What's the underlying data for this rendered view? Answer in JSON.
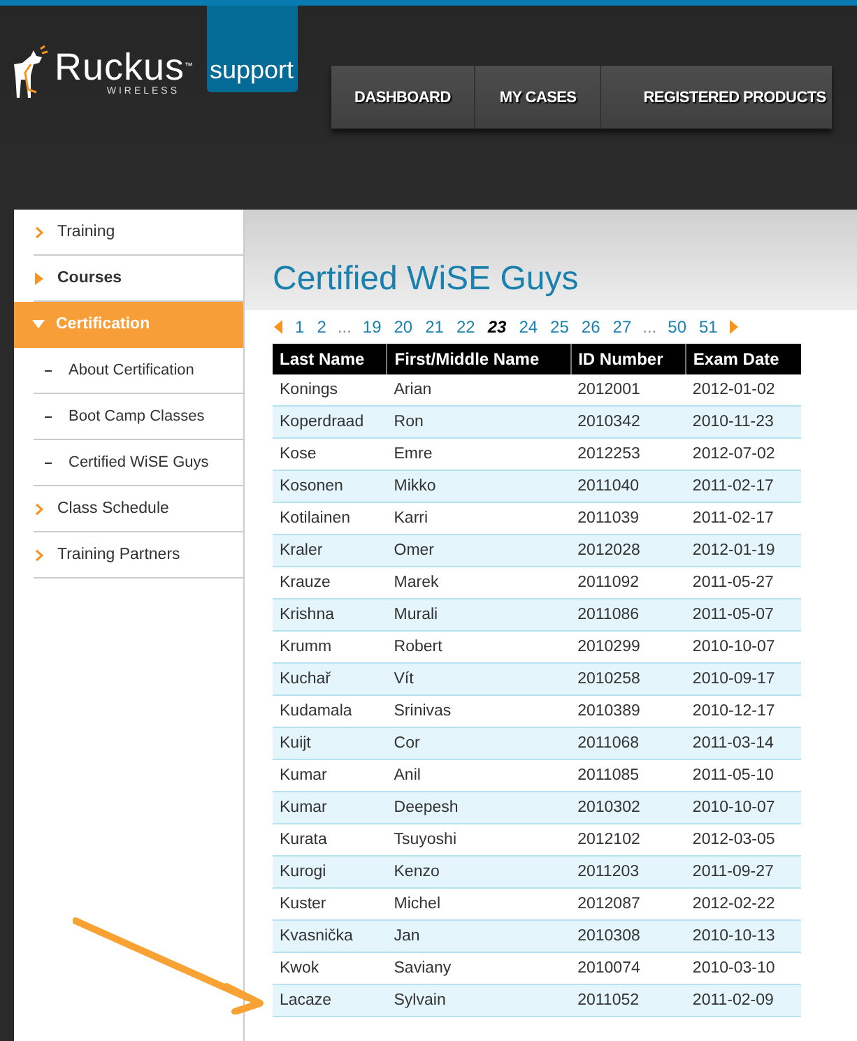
{
  "header": {
    "logo_text": "Ruckus",
    "logo_subtext": "WIRELESS",
    "logo_tm": "™",
    "support_tab": "support",
    "nav": [
      {
        "label": "DASHBOARD"
      },
      {
        "label": "MY CASES"
      },
      {
        "label": "REGISTERED PRODUCTS"
      }
    ]
  },
  "sidebar": {
    "items": [
      {
        "label": "Training",
        "kind": "link",
        "selected": false
      },
      {
        "label": "Courses",
        "kind": "bold",
        "selected": false
      },
      {
        "label": "Certification",
        "kind": "parent",
        "selected": true,
        "expanded": true
      },
      {
        "label": "About Certification",
        "kind": "sub",
        "selected": false
      },
      {
        "label": "Boot Camp Classes",
        "kind": "sub",
        "selected": false
      },
      {
        "label": "Certified WiSE Guys",
        "kind": "sub",
        "selected": false
      },
      {
        "label": "Class Schedule",
        "kind": "link",
        "selected": false
      },
      {
        "label": "Training Partners",
        "kind": "link",
        "selected": false
      }
    ]
  },
  "page_title": "Certified WiSE Guys",
  "pagination": [
    {
      "label": "1",
      "kind": "page",
      "selected": false
    },
    {
      "label": "2",
      "kind": "page",
      "selected": false
    },
    {
      "label": "...",
      "kind": "ellipsis"
    },
    {
      "label": "19",
      "kind": "page",
      "selected": false
    },
    {
      "label": "20",
      "kind": "page",
      "selected": false
    },
    {
      "label": "21",
      "kind": "page",
      "selected": false
    },
    {
      "label": "22",
      "kind": "page",
      "selected": false
    },
    {
      "label": "23",
      "kind": "page",
      "selected": true
    },
    {
      "label": "24",
      "kind": "page",
      "selected": false
    },
    {
      "label": "25",
      "kind": "page",
      "selected": false
    },
    {
      "label": "26",
      "kind": "page",
      "selected": false
    },
    {
      "label": "27",
      "kind": "page",
      "selected": false
    },
    {
      "label": "...",
      "kind": "ellipsis"
    },
    {
      "label": "50",
      "kind": "page",
      "selected": false
    },
    {
      "label": "51",
      "kind": "page",
      "selected": false
    }
  ],
  "table": {
    "columns": [
      "Last Name",
      "First/Middle Name",
      "ID Number",
      "Exam Date"
    ],
    "rows": [
      [
        "Konings",
        "Arian",
        "2012001",
        "2012-01-02"
      ],
      [
        "Koperdraad",
        "Ron",
        "2010342",
        "2010-11-23"
      ],
      [
        "Kose",
        "Emre",
        "2012253",
        "2012-07-02"
      ],
      [
        "Kosonen",
        "Mikko",
        "2011040",
        "2011-02-17"
      ],
      [
        "Kotilainen",
        "Karri",
        "2011039",
        "2011-02-17"
      ],
      [
        "Kraler",
        "Omer",
        "2012028",
        "2012-01-19"
      ],
      [
        "Krauze",
        "Marek",
        "2011092",
        "2011-05-27"
      ],
      [
        "Krishna",
        "Murali",
        "2011086",
        "2011-05-07"
      ],
      [
        "Krumm",
        "Robert",
        "2010299",
        "2010-10-07"
      ],
      [
        "Kuchař",
        "Vít",
        "2010258",
        "2010-09-17"
      ],
      [
        "Kudamala",
        "Srinivas",
        "2010389",
        "2010-12-17"
      ],
      [
        "Kuijt",
        "Cor",
        "2011068",
        "2011-03-14"
      ],
      [
        "Kumar",
        "Anil",
        "2011085",
        "2011-05-10"
      ],
      [
        "Kumar",
        "Deepesh",
        "2010302",
        "2010-10-07"
      ],
      [
        "Kurata",
        "Tsuyoshi",
        "2012102",
        "2012-03-05"
      ],
      [
        "Kurogi",
        "Kenzo",
        "2011203",
        "2011-09-27"
      ],
      [
        "Kuster",
        "Michel",
        "2012087",
        "2012-02-22"
      ],
      [
        "Kvasnička",
        "Jan",
        "2010308",
        "2010-10-13"
      ],
      [
        "Kwok",
        "Saviany",
        "2010074",
        "2010-03-10"
      ],
      [
        "Lacaze",
        "Sylvain",
        "2011052",
        "2011-02-09"
      ]
    ]
  }
}
